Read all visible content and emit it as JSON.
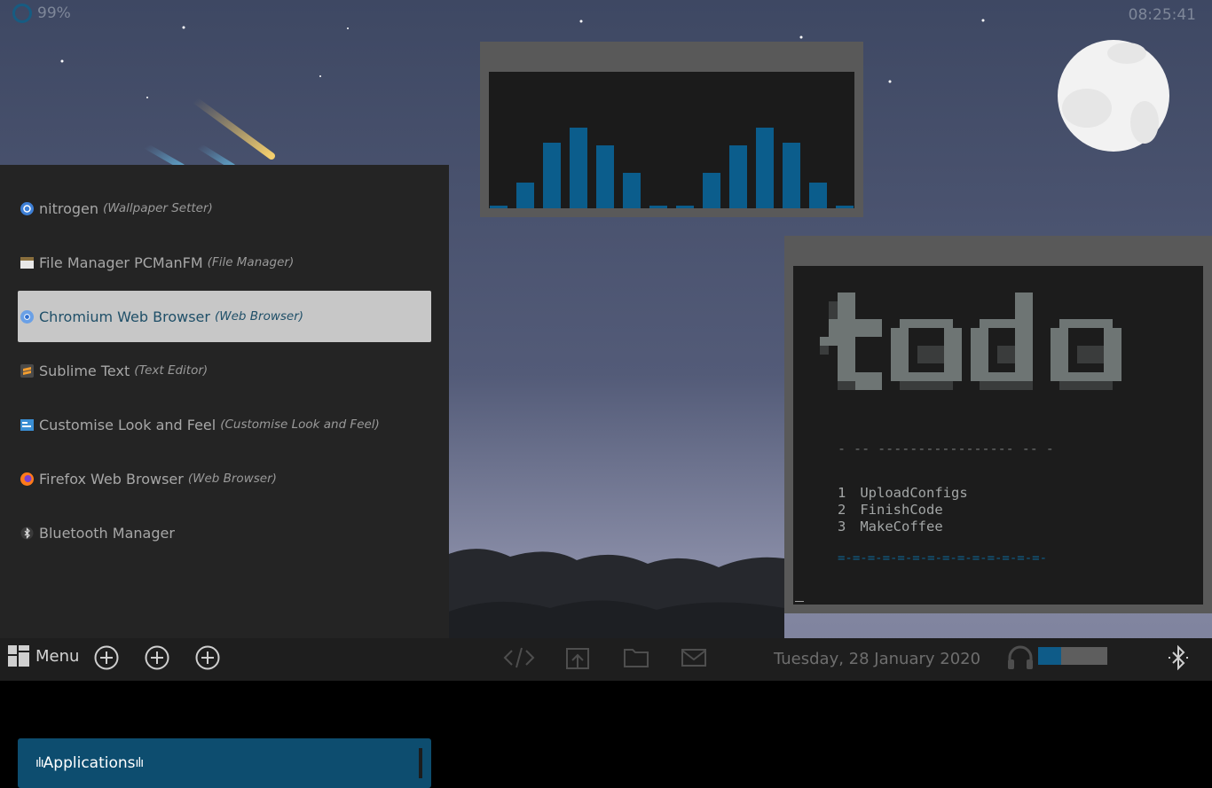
{
  "top": {
    "cpu": "99%",
    "clock": "08:25:41"
  },
  "menu": {
    "items": [
      {
        "name": "nitrogen",
        "desc": "(Wallpaper Setter)",
        "icon": "nitrogen-icon"
      },
      {
        "name": "File Manager PCManFM",
        "desc": "(File Manager)",
        "icon": "file-manager-icon"
      },
      {
        "name": "Chromium Web Browser",
        "desc": "(Web Browser)",
        "icon": "chromium-icon"
      },
      {
        "name": "Sublime Text",
        "desc": "(Text Editor)",
        "icon": "sublime-icon"
      },
      {
        "name": "Customise Look and Feel",
        "desc": "(Customise Look and Feel)",
        "icon": "appearance-icon"
      },
      {
        "name": "Firefox Web Browser",
        "desc": "(Web Browser)",
        "icon": "firefox-icon"
      },
      {
        "name": "Bluetooth Manager",
        "desc": "",
        "icon": "bluetooth-icon"
      }
    ],
    "selected_index": 2,
    "search_label": "Applications"
  },
  "visualizer": {
    "levels": [
      0.02,
      0.19,
      0.48,
      0.59,
      0.46,
      0.26,
      0.02,
      0.02,
      0.26,
      0.46,
      0.59,
      0.48,
      0.19,
      0.02
    ]
  },
  "todo": {
    "banner": "todo",
    "separator": "- -- ----------------- -- -",
    "tasks": [
      {
        "num": "1",
        "text": "UploadConfigs"
      },
      {
        "num": "2",
        "text": "FinishCode"
      },
      {
        "num": "3",
        "text": "MakeCoffee"
      }
    ],
    "footer": "=-=-=-=-=-=-=-=-=-=-=-=-=-=-"
  },
  "taskbar": {
    "menu_label": "Menu",
    "date": "Tuesday, 28 January 2020",
    "volume": 0.33
  },
  "colors": {
    "accent": "#0d4d6f",
    "panel": "#242424",
    "taskbar": "#1e1e1e",
    "sky_top": "#3e4863",
    "sky_bottom": "#8a8ea8"
  }
}
